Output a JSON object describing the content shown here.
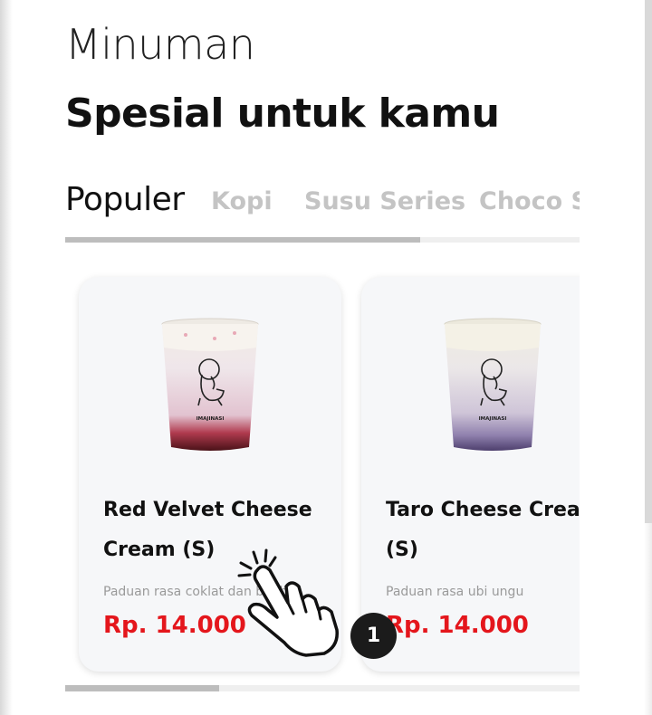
{
  "header": {
    "eyebrow": "Minuman",
    "title": "Spesial untuk kamu"
  },
  "tabs": [
    {
      "label": "Populer",
      "active": true
    },
    {
      "label": "Kopi",
      "active": false
    },
    {
      "label": "Susu Series",
      "active": false
    },
    {
      "label": "Choco Series",
      "active": false
    }
  ],
  "tab_scroll_fraction": 0.69,
  "products": [
    {
      "name": "Red Velvet Cheese Cream (S)",
      "description": "Paduan rasa coklat dan buah",
      "price": "Rp. 14.000",
      "cup_logo_text": "IMAJINASI",
      "image_icon": "red-velvet-drink-cup-icon"
    },
    {
      "name": "Taro Cheese Cream (S)",
      "description": "Paduan rasa ubi ungu",
      "price": "Rp. 14.000",
      "cup_logo_text": "IMAJINASI",
      "image_icon": "taro-drink-cup-icon"
    }
  ],
  "product_scroll_fraction": 0.3,
  "tutorial": {
    "step": "1",
    "pointer_icon": "tap-hand-icon"
  },
  "colors": {
    "price": "#e4161c",
    "active_tab": "#111111",
    "inactive_tab": "#c4c4c4",
    "card_bg": "#f6f7f9",
    "badge_bg": "#1b1b1b"
  }
}
